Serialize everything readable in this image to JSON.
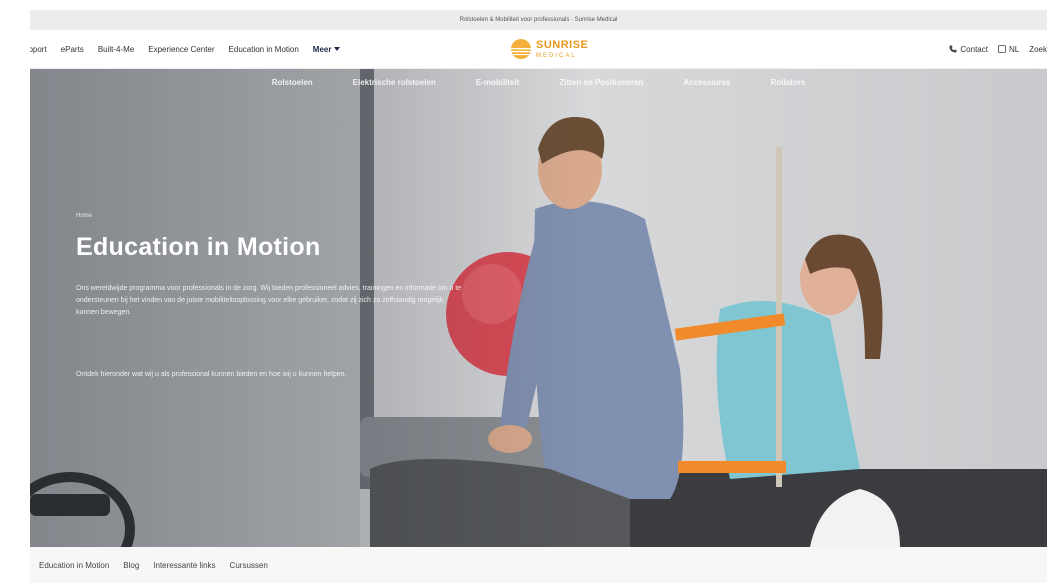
{
  "announcement": "Rolstoelen & Mobiliteit voor professionals · Sunrise Medical",
  "nav": {
    "left_items": [
      "upport",
      "eParts",
      "Built-4-Me",
      "Experience Center",
      "Education in Motion"
    ],
    "more_label": "Meer",
    "logo": {
      "name": "SUNRISE",
      "sub": "MEDICAL"
    },
    "contact_label": "Contact",
    "language_label": "NL",
    "search_label": "Zoek"
  },
  "subnav": [
    "Rolstoelen",
    "Elektrische rolstoelen",
    "E-mobiliteit",
    "Zitten en Positioneren",
    "Accessoires",
    "Rollators"
  ],
  "hero": {
    "breadcrumb": "Home",
    "title": "Education in Motion",
    "paragraph1": "Ons wereldwijde programma voor professionals in de zorg. Wij bieden professioneel advies, trainingen en informatie om u te ondersteunen bij het vinden van de juiste mobiliteitsoplossing voor elke gebruiker, zodat zij zich zo zelfstandig mogelijk kunnen bewegen.",
    "paragraph2": "Ontdek hieronder wat wij u als professional kunnen bieden en hoe wij u kunnen helpen."
  },
  "tabs": [
    "Education in Motion",
    "Blog",
    "Interessante links",
    "Cursussen"
  ],
  "colors": {
    "brand_orange": "#e89a1c",
    "nav_text": "#333333",
    "hero_text": "#ffffff"
  }
}
